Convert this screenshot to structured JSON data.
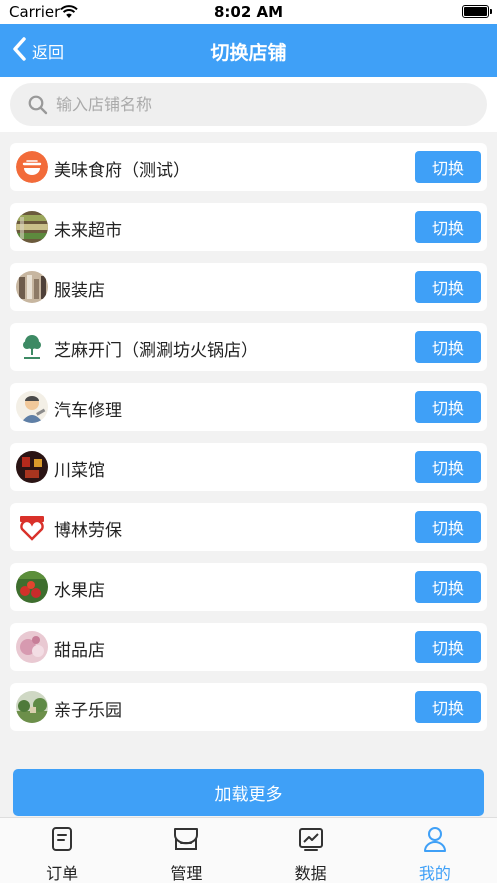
{
  "status_bar": {
    "carrier": "Carrier",
    "time": "8:02 AM"
  },
  "nav": {
    "back_label": "返回",
    "title": "切换店铺"
  },
  "search": {
    "placeholder": "输入店铺名称",
    "value": ""
  },
  "stores": [
    {
      "name": "美味食府（测试）",
      "button": "切换",
      "icon": "bowl-logo-icon"
    },
    {
      "name": "未来超市",
      "button": "切换",
      "icon": "supermarket-photo-icon"
    },
    {
      "name": "服装店",
      "button": "切换",
      "icon": "clothing-photo-icon"
    },
    {
      "name": "芝麻开门（涮涮坊火锅店）",
      "button": "切换",
      "icon": "tree-logo-icon"
    },
    {
      "name": "汽车修理",
      "button": "切换",
      "icon": "mechanic-cartoon-icon"
    },
    {
      "name": "川菜馆",
      "button": "切换",
      "icon": "sichuan-food-photo-icon"
    },
    {
      "name": "博林劳保",
      "button": "切换",
      "icon": "safety-badge-icon"
    },
    {
      "name": "水果店",
      "button": "切换",
      "icon": "fruit-photo-icon"
    },
    {
      "name": "甜品店",
      "button": "切换",
      "icon": "dessert-photo-icon"
    },
    {
      "name": "亲子乐园",
      "button": "切换",
      "icon": "park-photo-icon"
    }
  ],
  "load_more": "加载更多",
  "tabs": [
    {
      "label": "订单",
      "icon": "order-icon",
      "active": false
    },
    {
      "label": "管理",
      "icon": "store-manage-icon",
      "active": false
    },
    {
      "label": "数据",
      "icon": "chart-icon",
      "active": false
    },
    {
      "label": "我的",
      "icon": "profile-icon",
      "active": true
    }
  ],
  "colors": {
    "primary": "#3fa0f7",
    "background": "#f2f2f2"
  }
}
